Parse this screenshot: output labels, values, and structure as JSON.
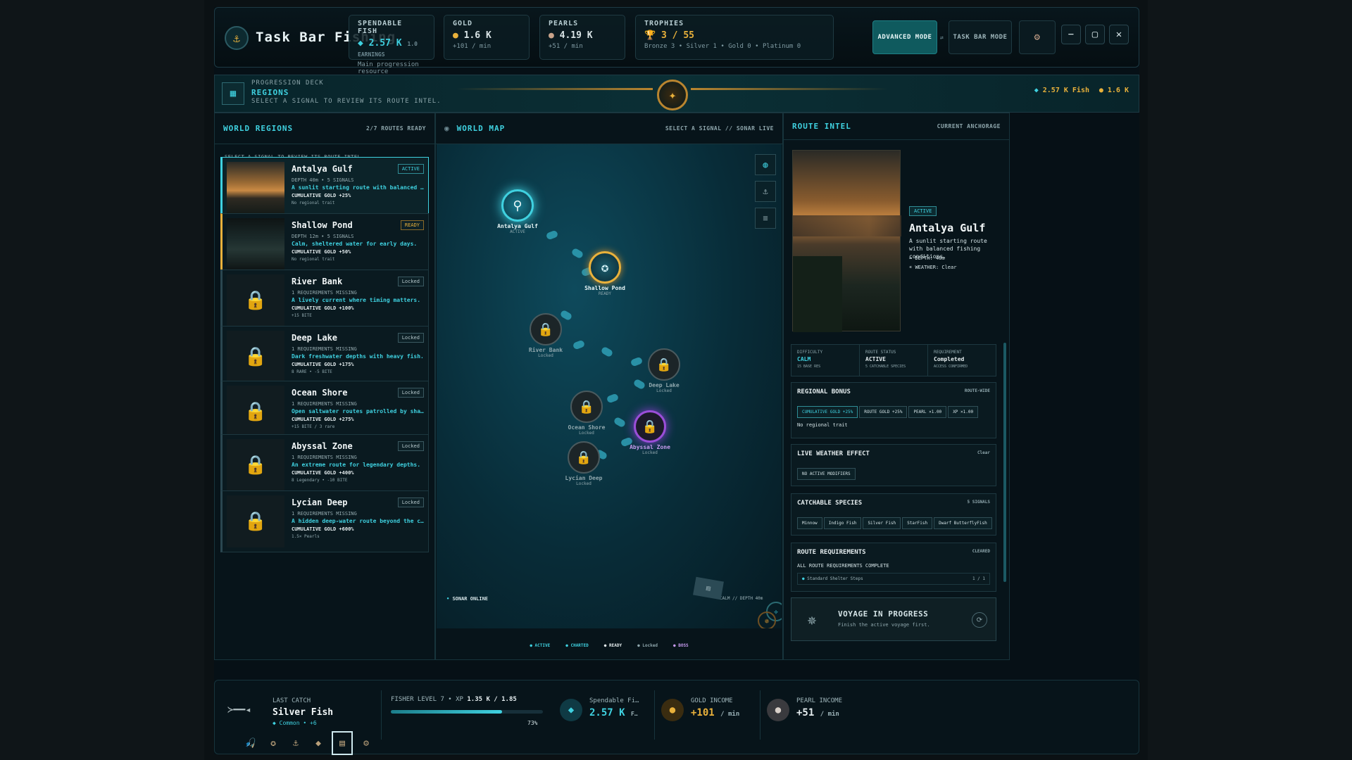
{
  "app": {
    "title": "Task Bar Fishing"
  },
  "stats": {
    "fish": {
      "label": "SPENDABLE FISH",
      "value": "2.57 K",
      "overlay": "1.0 EARNINGS",
      "sub": "Main progression resource"
    },
    "gold": {
      "label": "GOLD",
      "value": "1.6 K",
      "sub": "+101 / min"
    },
    "pearls": {
      "label": "PEARLS",
      "value": "4.19 K",
      "sub": "+51 / min"
    },
    "trophies": {
      "label": "TROPHIES",
      "value": "3 / 55",
      "sub": "Bronze 3 • Silver 1 • Gold 0 • Platinum 0"
    }
  },
  "modes": {
    "advanced": "ADVANCED MODE",
    "taskbar": "TASK BAR MODE"
  },
  "banner": {
    "kicker": "PROGRESSION DECK",
    "title": "REGIONS",
    "hint": "SELECT A SIGNAL TO REVIEW ITS ROUTE INTEL.",
    "fish": "2.57 K Fish",
    "gold": "1.6 K"
  },
  "regions_panel": {
    "title": "WORLD REGIONS",
    "count": "2/7 ROUTES READY",
    "hint": "SELECT A SIGNAL TO REVIEW ITS ROUTE INTEL."
  },
  "regions": [
    {
      "name": "Antalya Gulf",
      "badge": "ACTIVE",
      "l1": "DEPTH 40m • 5 SIGNALS",
      "l2": "A sunlit starting route with balanced fishing conditions.",
      "l3": "CUMULATIVE GOLD +25%",
      "l4": "No regional trait"
    },
    {
      "name": "Shallow Pond",
      "badge": "READY",
      "l1": "DEPTH 12m • 5 SIGNALS",
      "l2": "Calm, sheltered water for early days.",
      "l3": "CUMULATIVE GOLD +50%",
      "l4": "No regional trait"
    },
    {
      "name": "River Bank",
      "badge": "Locked",
      "l1": "1 REQUIREMENTS MISSING",
      "l2": "A lively current where timing matters.",
      "l3": "CUMULATIVE GOLD +100%",
      "l4": "+15 BITE"
    },
    {
      "name": "Deep Lake",
      "badge": "Locked",
      "l1": "1 REQUIREMENTS MISSING",
      "l2": "Dark freshwater depths with heavy fish.",
      "l3": "CUMULATIVE GOLD +175%",
      "l4": "8 RARE • -5 BITE"
    },
    {
      "name": "Ocean Shore",
      "badge": "Locked",
      "l1": "1 REQUIREMENTS MISSING",
      "l2": "Open saltwater routes patrolled by sharks.",
      "l3": "CUMULATIVE GOLD +275%",
      "l4": "+15 BITE / 3 rare"
    },
    {
      "name": "Abyssal Zone",
      "badge": "Locked",
      "l1": "1 REQUIREMENTS MISSING",
      "l2": "An extreme route for legendary depths.",
      "l3": "CUMULATIVE GOLD +400%",
      "l4": "8 Legendary • -10 BITE"
    },
    {
      "name": "Lycian Deep",
      "badge": "Locked",
      "l1": "1 REQUIREMENTS MISSING",
      "l2": "A hidden deep-water route beyond the cliffs.",
      "l3": "CUMULATIVE GOLD +600%",
      "l4": "1.5× Pearls"
    }
  ],
  "map": {
    "title": "WORLD MAP",
    "hint": "SELECT A SIGNAL // SONAR LIVE",
    "sonar": "SONAR ONLINE",
    "depth": "CALM // DEPTH 40m",
    "legend": [
      "ACTIVE",
      "CHARTED",
      "READY",
      "Locked",
      "BOSS"
    ],
    "nodes": [
      {
        "name": "Antalya Gulf",
        "state": "ACTIVE"
      },
      {
        "name": "Shallow Pond",
        "state": "READY"
      },
      {
        "name": "River Bank",
        "state": "Locked"
      },
      {
        "name": "Deep Lake",
        "state": "Locked"
      },
      {
        "name": "Ocean Shore",
        "state": "Locked"
      },
      {
        "name": "Abyssal Zone",
        "state": "Locked"
      },
      {
        "name": "Lycian Deep",
        "state": "Locked"
      }
    ]
  },
  "intel": {
    "title": "ROUTE INTEL",
    "anchor": "CURRENT ANCHORAGE",
    "badge": "ACTIVE",
    "name": "Antalya Gulf",
    "desc": "A sunlit starting route with balanced fishing conditions.",
    "depth": "DEPTH: 40m",
    "weather": "WEATHER: Clear",
    "difficulty": {
      "label": "DIFFICULTY",
      "value": "CALM",
      "sub": "15 BASE RES"
    },
    "status": {
      "label": "ROUTE STATUS",
      "value": "ACTIVE",
      "sub": "5 CATCHABLE SPECIES"
    },
    "requirement": {
      "label": "REQUIREMENT",
      "value": "Completed",
      "sub": "ACCESS CONFIRMED"
    },
    "bonus": {
      "title": "REGIONAL BONUS",
      "tag": "ROUTE-WIDE",
      "chips": [
        "CUMULATIVE GOLD +25%",
        "ROUTE GOLD +25%",
        "PEARL ×1.00",
        "XP ×1.00"
      ],
      "note": "No regional trait"
    },
    "weather_box": {
      "title": "LIVE WEATHER EFFECT",
      "tag": "Clear",
      "chip": "NO ACTIVE MODIFIERS"
    },
    "species": {
      "title": "CATCHABLE SPECIES",
      "tag": "5 SIGNALS",
      "chips": [
        "Minnow",
        "Indigo Fish",
        "Silver Fish",
        "StarFish",
        "Dwarf ButterflyFish"
      ]
    },
    "reqs": {
      "title": "ROUTE REQUIREMENTS",
      "tag": "CLEARED",
      "note": "ALL ROUTE REQUIREMENTS COMPLETE",
      "row": "Standard Shelter Steps",
      "row_val": "1 / 1"
    },
    "voyage": {
      "title": "VOYAGE IN PROGRESS",
      "sub": "Finish the active voyage first."
    }
  },
  "bottom": {
    "catch_label": "LAST CATCH",
    "catch_name": "Silver Fish",
    "catch_rarity": "Common • +6",
    "level": "FISHER LEVEL 7 • XP",
    "xp": "1.35 K / 1.85",
    "xp_pct": "73%",
    "xp_fraction": 0.73,
    "fish_label": "Spendable Fi…",
    "fish_value": "2.57 K",
    "fish_unit": "F…",
    "gold_label": "GOLD INCOME",
    "gold_value": "+101",
    "gold_unit": "/ min",
    "pearl_label": "PEARL INCOME",
    "pearl_value": "+51",
    "pearl_unit": "/ min"
  }
}
